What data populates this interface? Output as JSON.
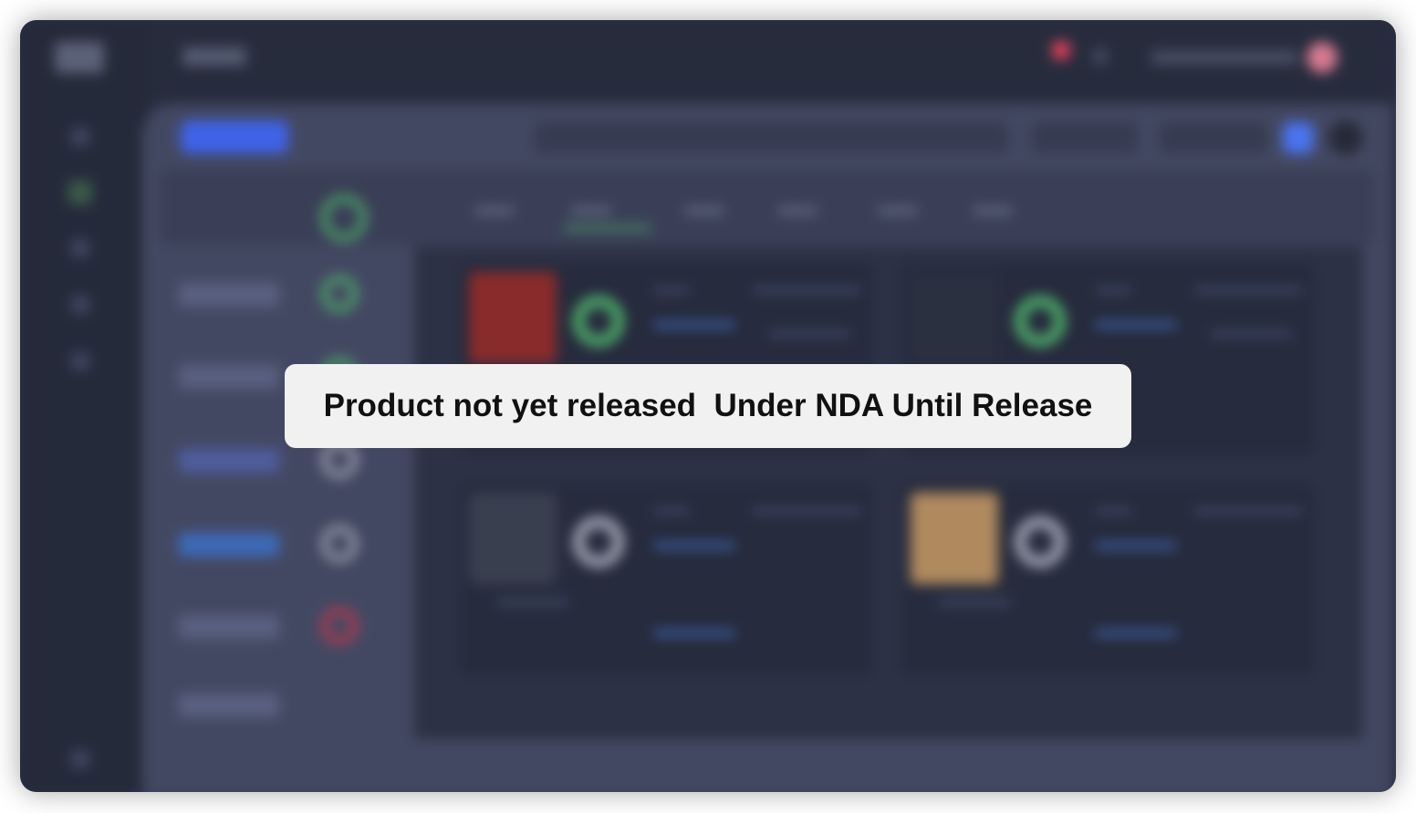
{
  "overlay": {
    "message": "Product not yet released  Under NDA Until Release"
  },
  "colors": {
    "banner_background": "#f1f1f1",
    "banner_text": "#111111",
    "app_background": "#2a2f42",
    "accent_blue": "#3f63e8",
    "status_green": "#4fae6b",
    "status_red": "#c0394f",
    "notification": "#d8405a"
  },
  "icons": [
    "app-logo-icon",
    "nav-home-icon",
    "nav-people-icon",
    "nav-chart-icon",
    "nav-calendar-icon",
    "nav-settings-icon",
    "notification-icon",
    "help-icon",
    "avatar"
  ]
}
